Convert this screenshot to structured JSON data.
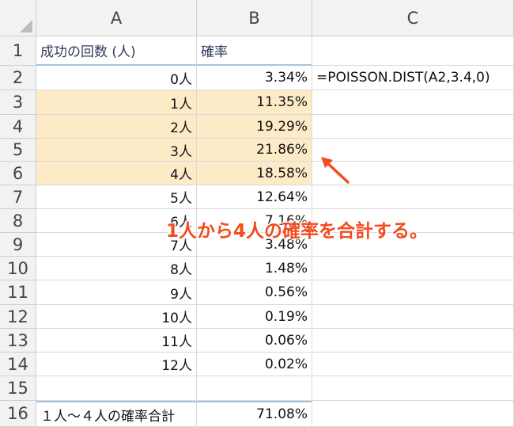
{
  "columns": [
    "A",
    "B",
    "C"
  ],
  "rows": [
    "1",
    "2",
    "3",
    "4",
    "5",
    "6",
    "7",
    "8",
    "9",
    "10",
    "11",
    "12",
    "13",
    "14",
    "15",
    "16"
  ],
  "cells": {
    "A1": "成功の回数 (人)",
    "B1": "確率",
    "A2": "0人",
    "B2": "3.34%",
    "C2": "=POISSON.DIST(A2,3.4,0)",
    "A3": "1人",
    "B3": "11.35%",
    "A4": "2人",
    "B4": "19.29%",
    "A5": "3人",
    "B5": "21.86%",
    "A6": "4人",
    "B6": "18.58%",
    "A7": "5人",
    "B7": "12.64%",
    "A8": "6人",
    "B8": "7.16%",
    "A9": "7人",
    "B9": "3.48%",
    "A10": "8人",
    "B10": "1.48%",
    "A11": "9人",
    "B11": "0.56%",
    "A12": "10人",
    "B12": "0.19%",
    "A13": "11人",
    "B13": "0.06%",
    "A14": "12人",
    "B14": "0.02%",
    "A16": "１人〜４人の確率合計",
    "B16": "71.08%"
  },
  "annotation": "1人から4人の確率を合計する。",
  "colors": {
    "highlight": "#fdebc8",
    "annotation": "#f24b1d",
    "border_accent": "#a8c4e0"
  }
}
